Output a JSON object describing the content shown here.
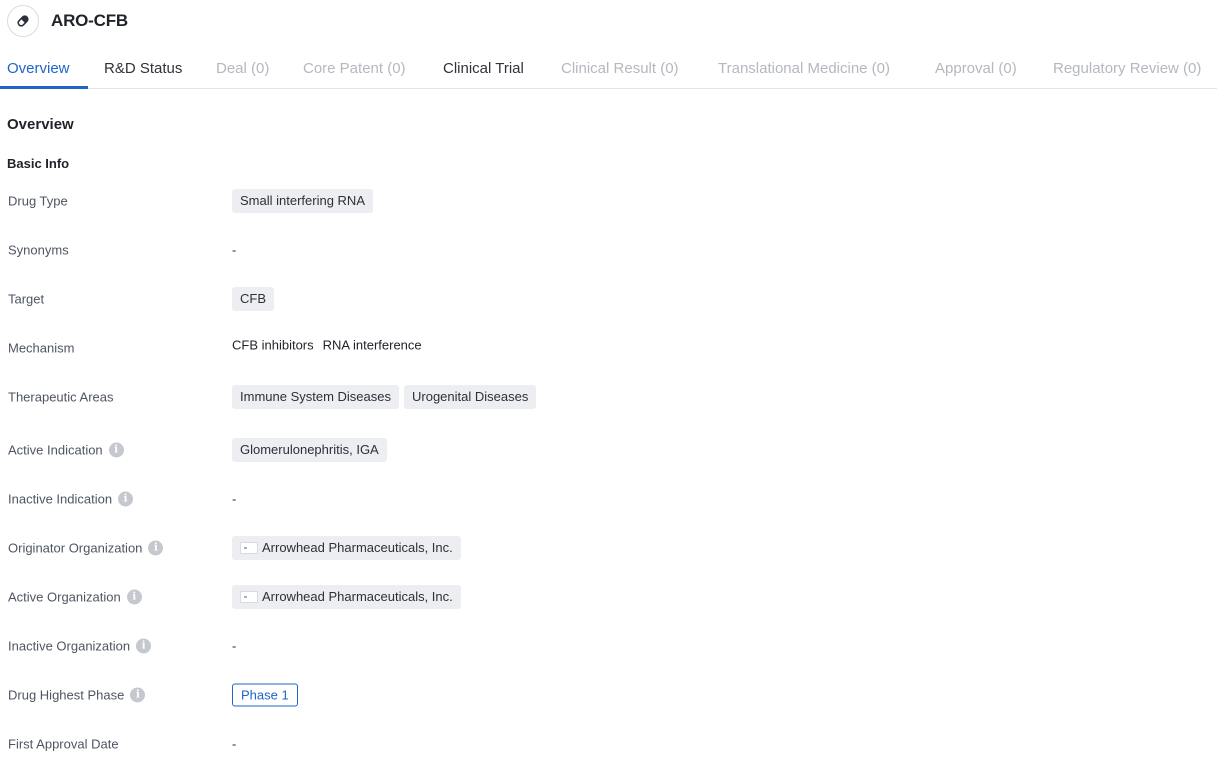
{
  "header": {
    "title": "ARO-CFB",
    "icon": "pill-icon"
  },
  "tabs": [
    {
      "label": "Overview",
      "state": "active"
    },
    {
      "label": "R&D Status",
      "state": "enabled"
    },
    {
      "label": "Deal (0)",
      "state": "disabled"
    },
    {
      "label": "Core Patent (0)",
      "state": "disabled"
    },
    {
      "label": "Clinical Trial",
      "state": "enabled"
    },
    {
      "label": "Clinical Result (0)",
      "state": "disabled"
    },
    {
      "label": "Translational Medicine (0)",
      "state": "disabled"
    },
    {
      "label": "Approval (0)",
      "state": "disabled"
    },
    {
      "label": "Regulatory Review (0)",
      "state": "disabled"
    }
  ],
  "section": {
    "title": "Overview",
    "subtitle": "Basic Info"
  },
  "fields": {
    "drug_type": {
      "label": "Drug Type",
      "chips": [
        "Small interfering RNA"
      ]
    },
    "synonyms": {
      "label": "Synonyms",
      "value": "-"
    },
    "target": {
      "label": "Target",
      "chips": [
        "CFB"
      ]
    },
    "mechanism": {
      "label": "Mechanism",
      "items": [
        "CFB inhibitors",
        "RNA interference"
      ]
    },
    "therapeutic_areas": {
      "label": "Therapeutic Areas",
      "chips": [
        "Immune System Diseases",
        "Urogenital Diseases"
      ]
    },
    "active_indication": {
      "label": "Active Indication",
      "chips": [
        "Glomerulonephritis, IGA"
      ]
    },
    "inactive_indication": {
      "label": "Inactive Indication",
      "value": "-"
    },
    "originator_org": {
      "label": "Originator Organization",
      "org": "Arrowhead Pharmaceuticals, Inc."
    },
    "active_org": {
      "label": "Active Organization",
      "org": "Arrowhead Pharmaceuticals, Inc."
    },
    "inactive_org": {
      "label": "Inactive Organization",
      "value": "-"
    },
    "highest_phase": {
      "label": "Drug Highest Phase",
      "badge": "Phase 1"
    },
    "first_approval": {
      "label": "First Approval Date",
      "value": "-"
    }
  },
  "colors": {
    "accent": "#1f64c8",
    "chip_bg": "#eceef1",
    "disabled_tab": "#b4b8bf"
  }
}
